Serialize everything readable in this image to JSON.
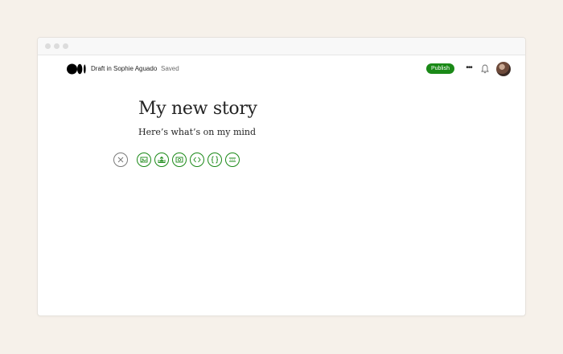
{
  "header": {
    "crumb": "Draft in Sophie Aguado",
    "status": "Saved",
    "publish_label": "Publish",
    "more_label": "•••"
  },
  "editor": {
    "title": "My new story",
    "subtitle": "Here’s what’s on my mind"
  },
  "toolbar": {
    "icons": [
      "close-icon",
      "image-icon",
      "upload-icon",
      "video-icon",
      "embed-icon",
      "code-icon",
      "divider-icon"
    ]
  },
  "colors": {
    "accent": "#1a8917",
    "background": "#f6f1ea"
  }
}
